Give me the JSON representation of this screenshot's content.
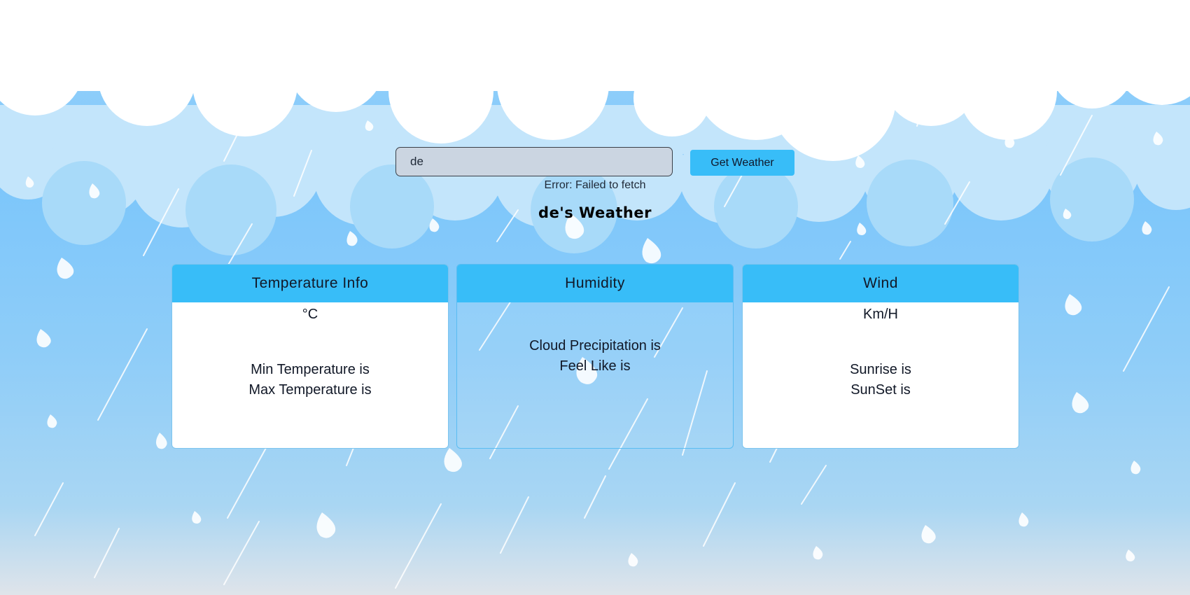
{
  "search": {
    "value": "de",
    "button_label": "Get Weather"
  },
  "status": {
    "error": "Error: Failed to fetch"
  },
  "title": "de's Weather",
  "cards": {
    "temperature": {
      "header": "Temperature Info",
      "value": "°C",
      "min_label": "Min Temperature is",
      "max_label": "Max Temperature is"
    },
    "humidity": {
      "header": "Humidity",
      "precip_label": "Cloud Precipitation is",
      "feels_label": "Feel Like is"
    },
    "wind": {
      "header": "Wind",
      "value": "Km/H",
      "sunrise_label": "Sunrise is",
      "sunset_label": "SunSet is"
    }
  },
  "colors": {
    "accent": "#38bdf8",
    "input_bg": "#cbd5e1",
    "sky": "#7cc6fb"
  }
}
